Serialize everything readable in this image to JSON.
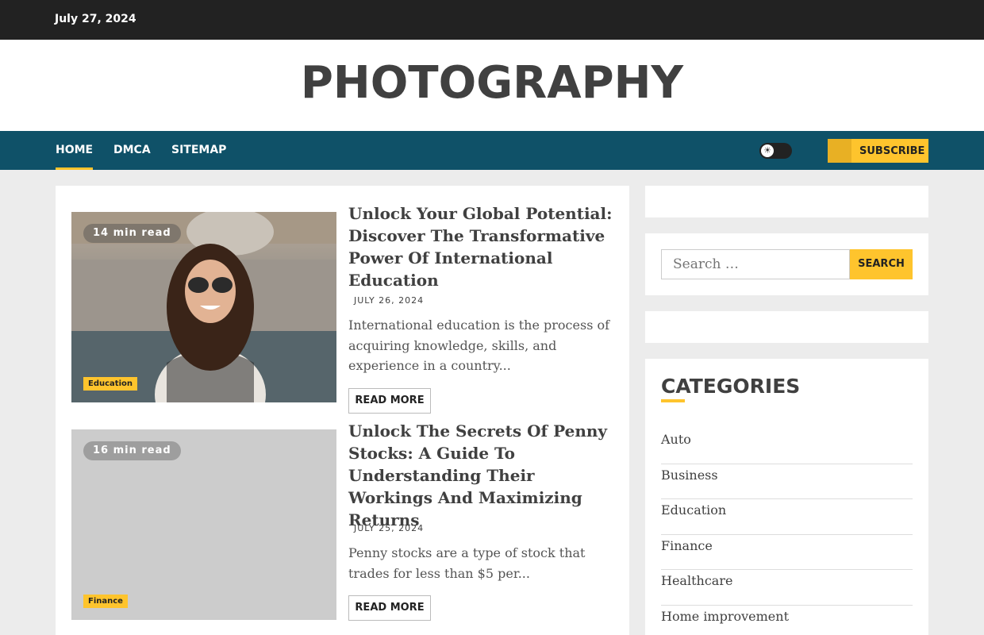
{
  "topbar": {
    "date": "July 27, 2024"
  },
  "site": {
    "title": "PHOTOGRAPHY"
  },
  "nav": {
    "items": [
      {
        "label": "Home",
        "active": true
      },
      {
        "label": "DMCA",
        "active": false
      },
      {
        "label": "Sitemap",
        "active": false
      }
    ],
    "theme_toggle_icon": "sun-icon",
    "subscribe_label": "Subscribe",
    "subscribe_icon": "bell-icon"
  },
  "colors": {
    "topbar": "#222222",
    "nav": "#0f5168",
    "accent": "#fec42d"
  },
  "posts": [
    {
      "read_time": "14 min read",
      "category": "Education",
      "title": "Unlock Your Global Potential: Discover The Transformative Power Of International Education",
      "date": "July 26, 2024",
      "excerpt": "International education is the process of acquiring knowledge, skills, and experience in a country...",
      "read_more": "Read More"
    },
    {
      "read_time": "16 min read",
      "category": "Finance",
      "title": "Unlock The Secrets Of Penny Stocks: A Guide To Understanding Their Workings And Maximizing Returns",
      "date": "July 25, 2024",
      "excerpt": "Penny stocks are a type of stock that trades for less than $5 per...",
      "read_more": "Read More"
    }
  ],
  "sidebar": {
    "search": {
      "placeholder": "Search …",
      "button_label": "Search"
    },
    "categories": {
      "heading": "Categories",
      "items": [
        "Auto",
        "Business",
        "Education",
        "Finance",
        "Healthcare",
        "Home improvement"
      ]
    }
  }
}
